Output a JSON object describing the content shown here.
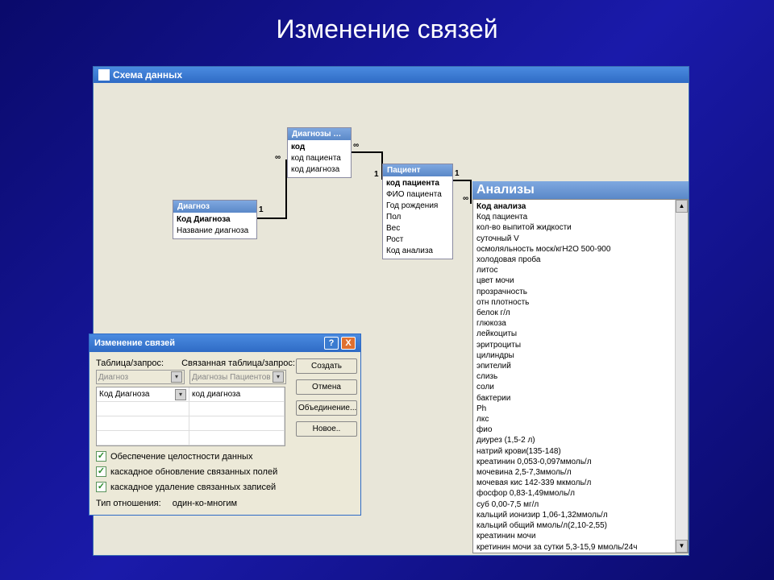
{
  "slide": {
    "title": "Изменение связей"
  },
  "schemaWindow": {
    "title": "Схема данных"
  },
  "tables": {
    "diagnoz": {
      "title": "Диагноз",
      "pk": "Код Диагноза",
      "f1": "Название диагноза"
    },
    "diagnozy": {
      "title": "Диагнозы …",
      "pk": "код",
      "f1": "код пациента",
      "f2": "код диагноза"
    },
    "patient": {
      "title": "Пациент",
      "pk": "код пациента",
      "f1": "ФИО пациента",
      "f2": "Год рождения",
      "f3": "Пол",
      "f4": "Вес",
      "f5": "Рост",
      "f6": "Код анализа"
    },
    "analizy": {
      "title": "Анализы",
      "fields": [
        "Код анализа",
        "Код пациента",
        "кол-во выпитой жидкости",
        "суточный V",
        "осмоляльность моск/кгН2О 500-900",
        "холодовая проба",
        "литос",
        "цвет мочи",
        "прозрачность",
        "отн плотность",
        "белок г/л",
        "глюкоза",
        "лейкоциты",
        "эритроциты",
        "цилиндры",
        "эпителий",
        "слизь",
        "соли",
        "бактерии",
        "Ph",
        "лкс",
        "фио",
        "диурез (1,5-2 л)",
        "натрий крови(135-148)",
        "креатинин 0,053-0,097ммоль/л",
        "мочевина 2,5-7,3ммоль/л",
        "мочевая кис 142-339 мкмоль/л",
        "фосфор 0,83-1,49ммоль/л",
        "суб 0,00-7,5 мг/л",
        "кальций ионизир 1,06-1,32ммоль/л",
        "кальций общий ммоль/л(2,10-2,55)",
        "креатинин мочи",
        "кретинин мочи за сутки 5,3-15,9 ммоль/24ч"
      ]
    }
  },
  "cardinality": {
    "one": "1",
    "many": "∞"
  },
  "dialog": {
    "title": "Изменение связей",
    "tableLbl": "Таблица/запрос:",
    "relatedLbl": "Связанная таблица/запрос:",
    "leftTable": "Диагноз",
    "rightTable": "Диагнозы Пациентов",
    "leftField": "Код Диагноза",
    "rightField": "код диагноза",
    "chk1": "Обеспечение целостности данных",
    "chk2": "каскадное обновление связанных полей",
    "chk3": "каскадное удаление связанных записей",
    "typeLbl": "Тип отношения:",
    "typeVal": "один-ко-многим",
    "btnCreate": "Создать",
    "btnCancel": "Отмена",
    "btnJoin": "Объединение...",
    "btnNew": "Новое.."
  }
}
